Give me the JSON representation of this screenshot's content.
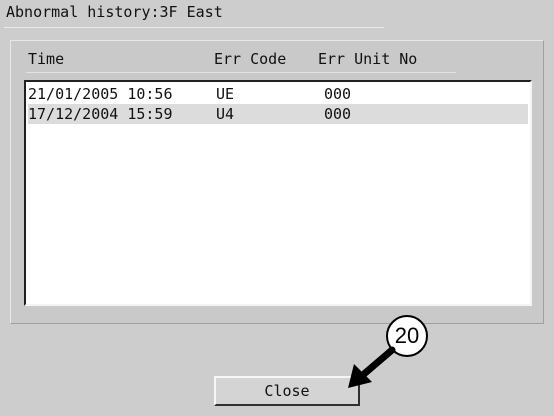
{
  "window": {
    "title": "Abnormal history:3F East"
  },
  "list": {
    "columns": [
      "Time",
      "Err Code",
      "Err Unit No"
    ],
    "rows": [
      {
        "time": "21/01/2005 10:56",
        "err_code": "UE",
        "err_unit_no": "000",
        "selected": false
      },
      {
        "time": "17/12/2004 15:59",
        "err_code": "U4",
        "err_unit_no": "000",
        "selected": true
      }
    ]
  },
  "buttons": {
    "close_label": "Close"
  },
  "annotation": {
    "number": "20"
  },
  "colors": {
    "window_bg": "#cdcdcd",
    "list_bg": "#ffffff",
    "selected_row_bg": "#dcdcdc",
    "text": "#111111"
  }
}
